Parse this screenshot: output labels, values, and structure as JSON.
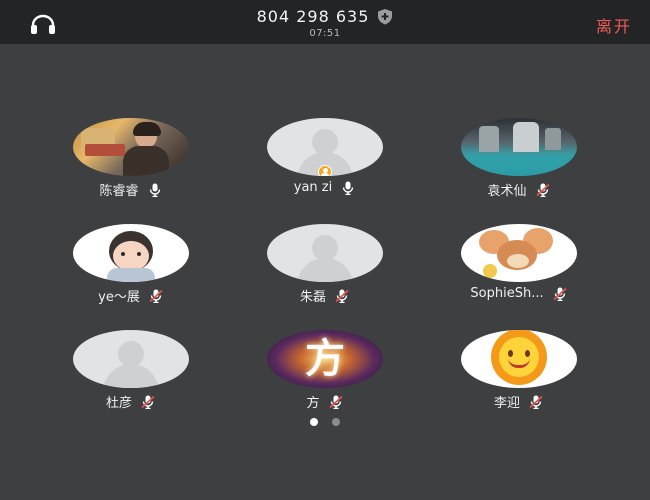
{
  "header": {
    "meeting_id": "804 298 635",
    "timer": "07:51",
    "leave_label": "离开"
  },
  "participants": [
    {
      "name": "陈睿睿",
      "mic": "on",
      "avatar": "photo-woman-food-stall"
    },
    {
      "name": "yan zi",
      "mic": "on",
      "avatar": "default",
      "host": true
    },
    {
      "name": "袁术仙",
      "mic": "muted",
      "avatar": "photo-cave-water"
    },
    {
      "name": "ye～展",
      "mic": "muted",
      "avatar": "cartoon-child"
    },
    {
      "name": "朱磊",
      "mic": "muted",
      "avatar": "default"
    },
    {
      "name": "SophieSh...",
      "mic": "muted",
      "avatar": "cartoon-mouse"
    },
    {
      "name": "杜彦",
      "mic": "muted",
      "avatar": "default"
    },
    {
      "name": "方",
      "mic": "muted",
      "avatar": "glowing-character-fang"
    },
    {
      "name": "李迎",
      "mic": "muted",
      "avatar": "smiling-sun"
    }
  ],
  "avatar_text": {
    "fang": "方"
  },
  "pager": {
    "current": 1,
    "total": 2
  },
  "colors": {
    "background": "#3d3f41",
    "topbar": "#232425",
    "leave": "#ef5b56",
    "muted": "#e2534f",
    "host_badge": "#f5a623"
  }
}
